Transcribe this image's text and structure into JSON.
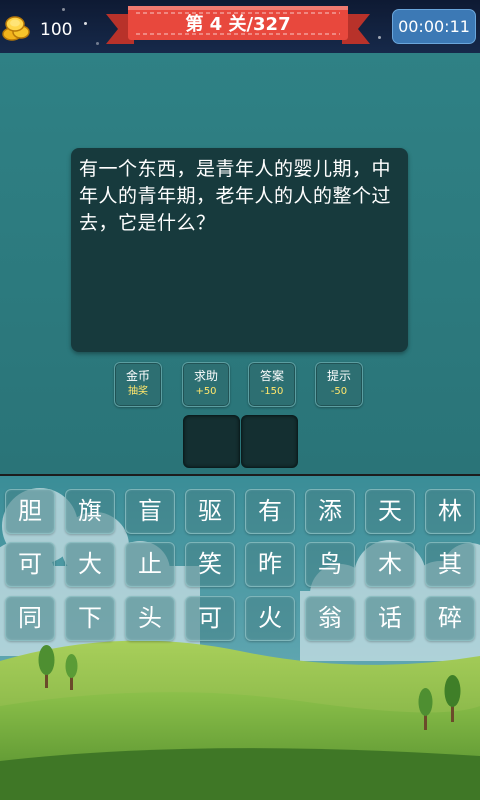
{
  "header": {
    "coins": "100",
    "level_text": "第 4 关/327",
    "timer": "00:00:11"
  },
  "question": {
    "text": "有一个东西，是青年人的婴儿期，中年人的青年期，老年人的人的整个过去，它是什么？"
  },
  "tools": [
    {
      "label": "金币",
      "sub": "抽奖"
    },
    {
      "label": "求助",
      "sub": "+50"
    },
    {
      "label": "答案",
      "sub": "-150"
    },
    {
      "label": "提示",
      "sub": "-50"
    }
  ],
  "answer_slots": 2,
  "char_grid": [
    [
      "胆",
      "旗",
      "盲",
      "驱",
      "有",
      "添",
      "天",
      "林"
    ],
    [
      "可",
      "大",
      "止",
      "笑",
      "昨",
      "鸟",
      "木",
      "其"
    ],
    [
      "同",
      "下",
      "头",
      "可",
      "火",
      "翁",
      "话",
      "碎"
    ]
  ],
  "colors": {
    "accent_ribbon": "#e8483d",
    "timer_bg": "#3c79b5",
    "tool_sub_text": "#ffe66b",
    "panel": "#173a3d",
    "background": "#2c7b7f"
  },
  "icons": {
    "coins": "gold-coins-icon"
  }
}
